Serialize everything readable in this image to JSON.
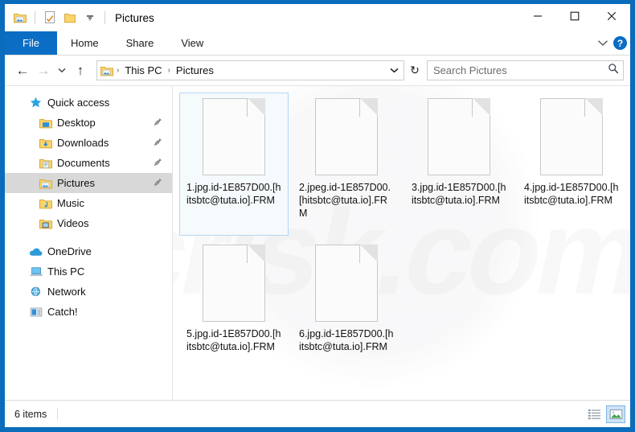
{
  "window": {
    "title": "Pictures",
    "quick_access_toolbar": [
      {
        "name": "pictures-folder-icon",
        "label": "Pictures folder"
      },
      {
        "name": "properties-icon",
        "label": "Properties"
      },
      {
        "name": "new-folder-icon",
        "label": "New folder"
      },
      {
        "name": "customize-dropdown-icon",
        "label": "Customize Quick Access Toolbar"
      }
    ],
    "controls": {
      "minimize": "—",
      "maximize": "☐",
      "close": "✕"
    }
  },
  "ribbon": {
    "tabs": [
      {
        "label": "File",
        "active": true
      },
      {
        "label": "Home",
        "active": false
      },
      {
        "label": "Share",
        "active": false
      },
      {
        "label": "View",
        "active": false
      }
    ],
    "expand_icon": "⌄",
    "help_label": "?"
  },
  "address": {
    "back_icon": "←",
    "forward_icon": "→",
    "recent_icon": "⌄",
    "up_icon": "↑",
    "breadcrumb": [
      "This PC",
      "Pictures"
    ],
    "breadcrumb_sep": "›",
    "dropdown_icon": "⌄",
    "refresh_icon": "↻"
  },
  "search": {
    "placeholder": "Search Pictures",
    "value": "",
    "icon": "search-icon"
  },
  "sidebar": {
    "items": [
      {
        "label": "Quick access",
        "icon": "star-icon",
        "indent": false,
        "pin": false,
        "selected": false
      },
      {
        "label": "Desktop",
        "icon": "desktop-folder-icon",
        "indent": true,
        "pin": true,
        "selected": false
      },
      {
        "label": "Downloads",
        "icon": "downloads-folder-icon",
        "indent": true,
        "pin": true,
        "selected": false
      },
      {
        "label": "Documents",
        "icon": "documents-folder-icon",
        "indent": true,
        "pin": true,
        "selected": false
      },
      {
        "label": "Pictures",
        "icon": "pictures-folder-icon",
        "indent": true,
        "pin": true,
        "selected": true
      },
      {
        "label": "Music",
        "icon": "music-folder-icon",
        "indent": true,
        "pin": false,
        "selected": false
      },
      {
        "label": "Videos",
        "icon": "videos-folder-icon",
        "indent": true,
        "pin": false,
        "selected": false
      },
      {
        "label": "OneDrive",
        "icon": "onedrive-cloud-icon",
        "indent": false,
        "pin": false,
        "selected": false
      },
      {
        "label": "This PC",
        "icon": "this-pc-icon",
        "indent": false,
        "pin": false,
        "selected": false
      },
      {
        "label": "Network",
        "icon": "network-icon",
        "indent": false,
        "pin": false,
        "selected": false
      },
      {
        "label": "Catch!",
        "icon": "catch-icon",
        "indent": false,
        "pin": false,
        "selected": false
      }
    ]
  },
  "files": [
    {
      "name": "1.jpg.id-1E857D00.[hitsbtc@tuta.io].FRM",
      "selected": true
    },
    {
      "name": "2.jpeg.id-1E857D00.[hitsbtc@tuta.io].FRM",
      "selected": false
    },
    {
      "name": "3.jpg.id-1E857D00.[hitsbtc@tuta.io].FRM",
      "selected": false
    },
    {
      "name": "4.jpg.id-1E857D00.[hitsbtc@tuta.io].FRM",
      "selected": false
    },
    {
      "name": "5.jpg.id-1E857D00.[hitsbtc@tuta.io].FRM",
      "selected": false
    },
    {
      "name": "6.jpg.id-1E857D00.[hitsbtc@tuta.io].FRM",
      "selected": false
    }
  ],
  "status": {
    "item_count": "6 items",
    "views": [
      {
        "name": "details-view-button",
        "active": false
      },
      {
        "name": "large-icons-view-button",
        "active": true
      }
    ]
  },
  "watermark": {
    "text": "pcrisk.com"
  },
  "colors": {
    "accent": "#0b6dc4",
    "window_border": "#0a6cbb",
    "selection": "#cce4f7",
    "sidebar_selected": "#d8d8d8"
  }
}
